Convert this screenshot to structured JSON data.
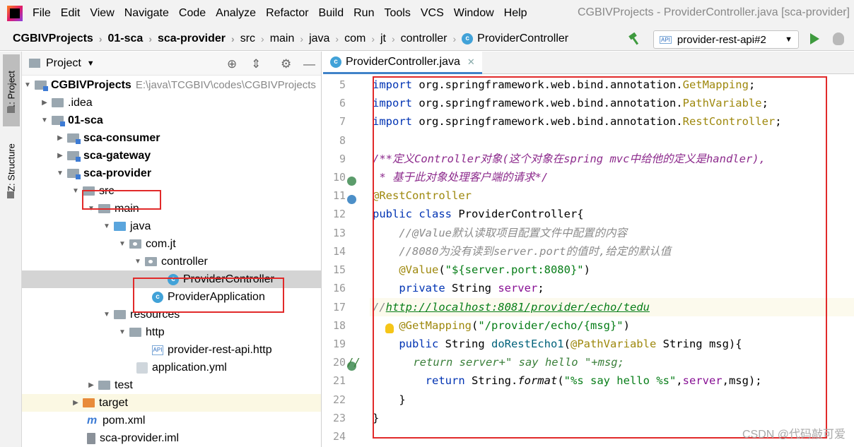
{
  "menubar": {
    "items": [
      "File",
      "Edit",
      "View",
      "Navigate",
      "Code",
      "Analyze",
      "Refactor",
      "Build",
      "Run",
      "Tools",
      "VCS",
      "Window",
      "Help"
    ],
    "window_title": "CGBIVProjects - ProviderController.java [sca-provider]"
  },
  "navbar": {
    "crumbs": [
      "CGBIVProjects",
      "01-sca",
      "sca-provider",
      "src",
      "main",
      "java",
      "com",
      "jt",
      "controller",
      "ProviderController"
    ],
    "run_config": "provider-rest-api#2"
  },
  "toolstrip": {
    "project_tab": "1: Project",
    "structure_tab": "Z: Structure"
  },
  "project_panel": {
    "title": "Project",
    "tree": [
      {
        "label": "CGBIVProjects",
        "path": "E:\\java\\TCGBIV\\codes\\CGBIVProjects"
      },
      {
        "label": ".idea"
      },
      {
        "label": "01-sca"
      },
      {
        "label": "sca-consumer"
      },
      {
        "label": "sca-gateway"
      },
      {
        "label": "sca-provider"
      },
      {
        "label": "src"
      },
      {
        "label": "main"
      },
      {
        "label": "java"
      },
      {
        "label": "com.jt"
      },
      {
        "label": "controller"
      },
      {
        "label": "ProviderController"
      },
      {
        "label": "ProviderApplication"
      },
      {
        "label": "resources"
      },
      {
        "label": "http"
      },
      {
        "label": "provider-rest-api.http"
      },
      {
        "label": "application.yml"
      },
      {
        "label": "test"
      },
      {
        "label": "target"
      },
      {
        "label": "pom.xml"
      },
      {
        "label": "sca-provider.iml"
      }
    ]
  },
  "editor": {
    "tab_label": "ProviderController.java",
    "line_numbers": [
      "5",
      "6",
      "7",
      "8",
      "9",
      "10",
      "11",
      "12",
      "13",
      "14",
      "15",
      "16",
      "17",
      "18",
      "19",
      "20",
      "21",
      "22",
      "23",
      "24"
    ],
    "code": {
      "l5_kw": "import",
      "l5_pkg": " org.springframework.web.bind.annotation.",
      "l5_cls": "GetMapping",
      "l5_end": ";",
      "l6_kw": "import",
      "l6_pkg": " org.springframework.web.bind.annotation.",
      "l6_cls": "PathVariable",
      "l6_end": ";",
      "l7_kw": "import",
      "l7_pkg": " org.springframework.web.bind.annotation.",
      "l7_cls": "RestController",
      "l7_end": ";",
      "l9": "/**定义Controller对象(这个对象在spring mvc中给他的定义是handler),",
      "l10": " * 基于此对象处理客户端的请求*/",
      "l11": "@RestController",
      "l12_kw": "public class",
      "l12_rest": " ProviderController{",
      "l13": "    //@Value默认读取项目配置文件中配置的内容",
      "l14": "    //8080为没有读到server.port的值时,给定的默认值",
      "l15_ann": "    @Value",
      "l15_p1": "(",
      "l15_str": "\"${server.port:8080}\"",
      "l15_p2": ")",
      "l16_kw": "    private",
      "l16_type": " String ",
      "l16_fld": "server",
      "l16_end": ";",
      "l17_pre": "//",
      "l17_url": "http://localhost:8081/provider/echo/tedu",
      "l18_ann": "    @GetMapping",
      "l18_p1": "(",
      "l18_str": "\"/provider/echo/{msg}\"",
      "l18_p2": ")",
      "l19_kw": "    public",
      "l19_mid": " String ",
      "l19_meth": "doRestEcho1",
      "l19_p1": "(",
      "l19_ann": "@PathVariable",
      "l19_rest": " String msg){",
      "l20": "//        return server+\" say hello \"+msg;",
      "l21_kw": "        return",
      "l21_mid": " String.",
      "l21_meth": "format",
      "l21_p1": "(",
      "l21_str": "\"%s say hello %s\"",
      "l21_c": ",",
      "l21_fld": "server",
      "l21_end": ",msg);",
      "l22": "    }",
      "l23": "}"
    }
  },
  "watermark": "CSDN @代码敲可爱",
  "colors": {
    "highlight_box": "#e12a2a",
    "keyword": "#0033b3",
    "annotation": "#9e880d",
    "string": "#067d17"
  }
}
